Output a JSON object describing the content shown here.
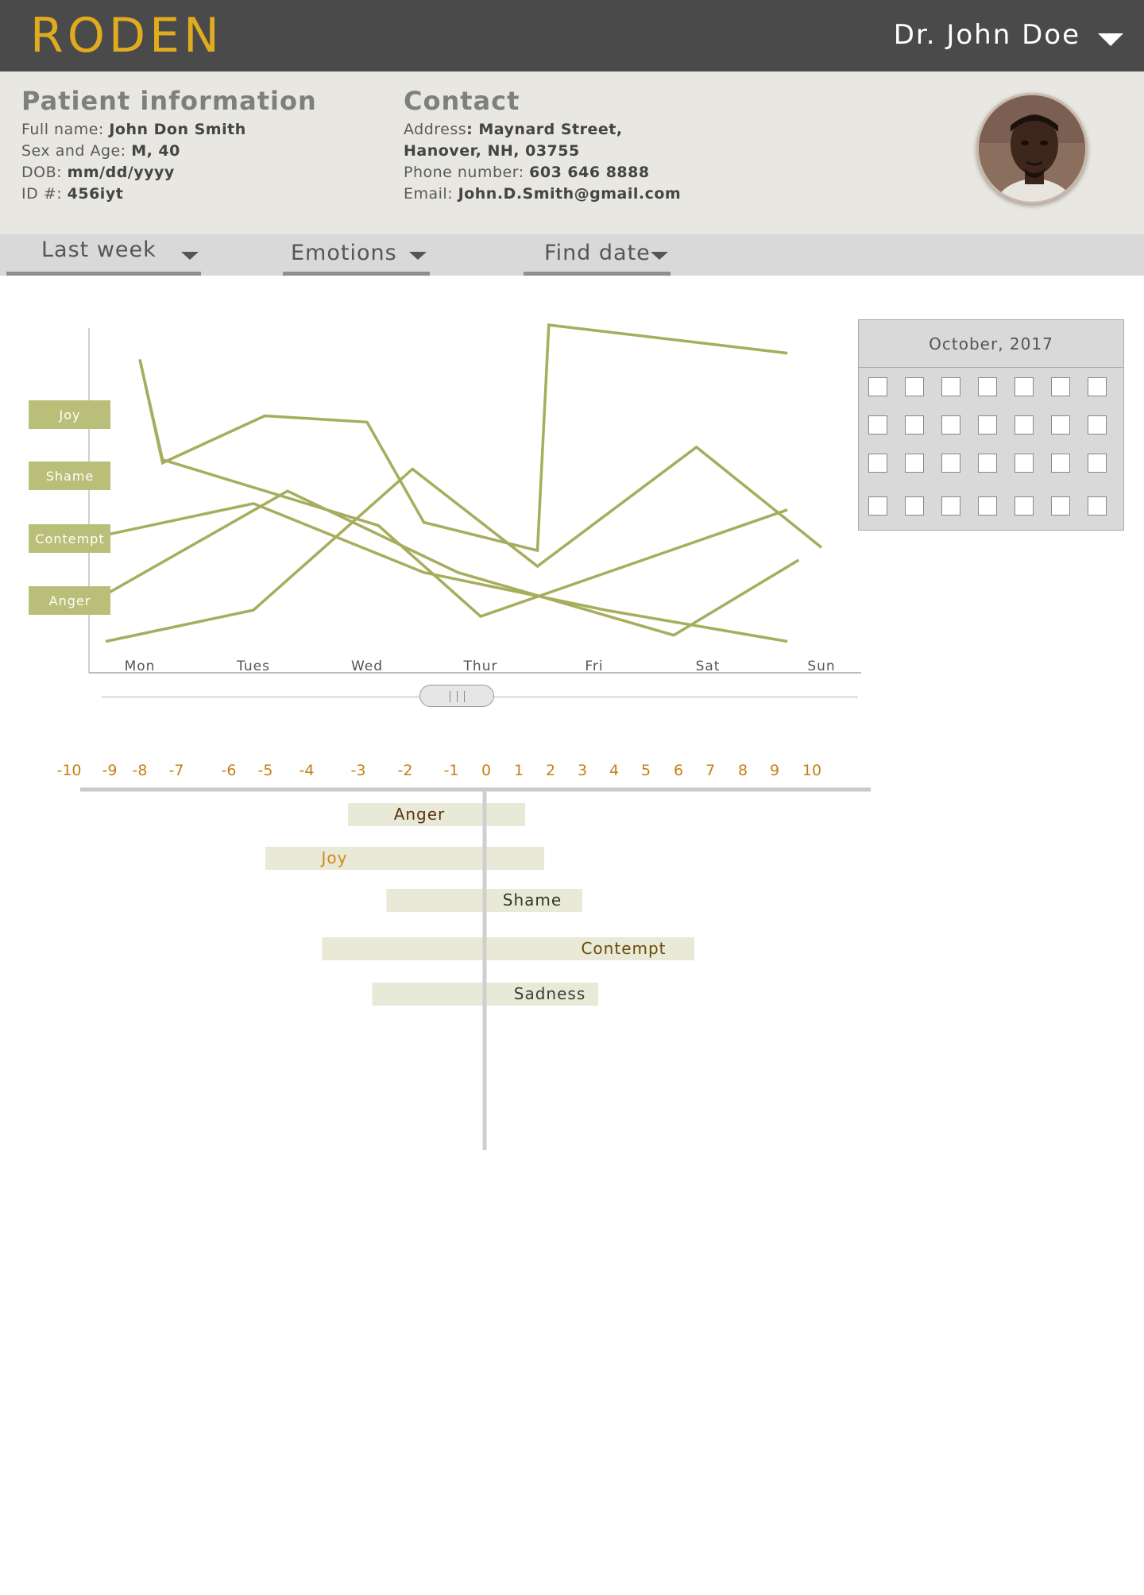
{
  "header": {
    "brand": "RODEN",
    "user_name": "Dr. John Doe",
    "user_menu_icon": "caret-down-icon"
  },
  "patient": {
    "title": "Patient information",
    "full_name_label": "Full name: ",
    "full_name": "John Don Smith",
    "sex_age_label": "Sex and Age: ",
    "sex_age": "M, 40",
    "dob_label": "DOB: ",
    "dob": "mm/dd/yyyy",
    "id_label": "ID #: ",
    "id": "456iyt"
  },
  "contact": {
    "title": "Contact",
    "address_label": "Address",
    "address_line1": ": Maynard Street,",
    "address_line2": "Hanover, NH, 03755",
    "phone_label": "Phone number: ",
    "phone": "603 646 8888",
    "email_label": "Email: ",
    "email": "John.D.Smith@gmail.com"
  },
  "filters": {
    "period": "Last week",
    "category": "Emotions",
    "find_date": "Find date"
  },
  "calendar": {
    "month": "October, 2017",
    "rows": 4,
    "cols": 7
  },
  "colors": {
    "brand": "#e0ab1e",
    "series": "#a6ad5c",
    "series_label_bg": "#b9bf78",
    "bar_fill": "#e8e9d6",
    "axis_tick": "#c77f14"
  },
  "chart_data": [
    {
      "type": "line",
      "title": "",
      "categories": [
        "Mon",
        "Tues",
        "Wed",
        "Thur",
        "Fri",
        "Sat",
        "Sun"
      ],
      "y_labels": [
        "Joy",
        "Shame",
        "Contempt",
        "Anger"
      ],
      "series": [
        {
          "x": [
            0,
            0.2,
            1.1,
            2.0,
            2.5,
            3.5,
            3.6,
            5.7
          ],
          "y": [
            1.0,
            0.67,
            0.82,
            0.8,
            0.48,
            0.39,
            1.11,
            1.02
          ]
        },
        {
          "x": [
            -0.3,
            1.0,
            2.5,
            4.1,
            5.7
          ],
          "y": [
            0.44,
            0.54,
            0.32,
            0.2,
            0.1
          ]
        },
        {
          "x": [
            -0.3,
            1.3,
            2.8,
            4.7,
            5.8
          ],
          "y": [
            0.25,
            0.58,
            0.32,
            0.12,
            0.36
          ]
        },
        {
          "x": [
            -0.3,
            1.0,
            2.4,
            3.5,
            4.9,
            6.0
          ],
          "y": [
            0.1,
            0.2,
            0.65,
            0.34,
            0.72,
            0.4
          ]
        },
        {
          "x": [
            0,
            0.2,
            2.1,
            3.0,
            5.7
          ],
          "y": [
            1.0,
            0.68,
            0.47,
            0.18,
            0.52
          ]
        }
      ]
    },
    {
      "type": "bar",
      "orientation": "horizontal",
      "x_ticks": [
        -10,
        -9,
        -8,
        -7,
        -6,
        -5,
        -4,
        -3,
        -2,
        -1,
        0,
        1,
        2,
        3,
        4,
        5,
        6,
        7,
        8,
        9,
        10
      ],
      "xlim": [
        -10,
        10
      ],
      "categories": [
        "Anger",
        "Joy",
        "Shame",
        "Contempt",
        "Sadness"
      ],
      "ranges": [
        [
          -3.2,
          1.2
        ],
        [
          -5.0,
          1.8
        ],
        [
          -2.4,
          3.0
        ],
        [
          -3.7,
          6.5
        ],
        [
          -2.7,
          3.5
        ]
      ]
    }
  ]
}
